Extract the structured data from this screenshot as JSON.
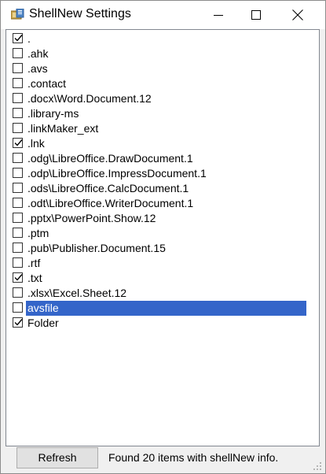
{
  "window": {
    "title": "ShellNew Settings",
    "title_icon": "shellnew-app-icon"
  },
  "caption": {
    "minimize_icon": "minimize-icon",
    "maximize_icon": "maximize-icon",
    "close_icon": "close-icon"
  },
  "items": [
    {
      "label": ".",
      "checked": true,
      "selected": false
    },
    {
      "label": ".ahk",
      "checked": false,
      "selected": false
    },
    {
      "label": ".avs",
      "checked": false,
      "selected": false
    },
    {
      "label": ".contact",
      "checked": false,
      "selected": false
    },
    {
      "label": ".docx\\Word.Document.12",
      "checked": false,
      "selected": false
    },
    {
      "label": ".library-ms",
      "checked": false,
      "selected": false
    },
    {
      "label": ".linkMaker_ext",
      "checked": false,
      "selected": false
    },
    {
      "label": ".lnk",
      "checked": true,
      "selected": false
    },
    {
      "label": ".odg\\LibreOffice.DrawDocument.1",
      "checked": false,
      "selected": false
    },
    {
      "label": ".odp\\LibreOffice.ImpressDocument.1",
      "checked": false,
      "selected": false
    },
    {
      "label": ".ods\\LibreOffice.CalcDocument.1",
      "checked": false,
      "selected": false
    },
    {
      "label": ".odt\\LibreOffice.WriterDocument.1",
      "checked": false,
      "selected": false
    },
    {
      "label": ".pptx\\PowerPoint.Show.12",
      "checked": false,
      "selected": false
    },
    {
      "label": ".ptm",
      "checked": false,
      "selected": false
    },
    {
      "label": ".pub\\Publisher.Document.15",
      "checked": false,
      "selected": false
    },
    {
      "label": ".rtf",
      "checked": false,
      "selected": false
    },
    {
      "label": ".txt",
      "checked": true,
      "selected": false
    },
    {
      "label": ".xlsx\\Excel.Sheet.12",
      "checked": false,
      "selected": false
    },
    {
      "label": "avsfile",
      "checked": false,
      "selected": true
    },
    {
      "label": "Folder",
      "checked": true,
      "selected": false
    }
  ],
  "footer": {
    "refresh_label": "Refresh",
    "status": "Found 20 items with shellNew info."
  },
  "colors": {
    "selection": "#3465c9",
    "window_bg": "#f0f0f0",
    "list_bg": "#ffffff"
  }
}
